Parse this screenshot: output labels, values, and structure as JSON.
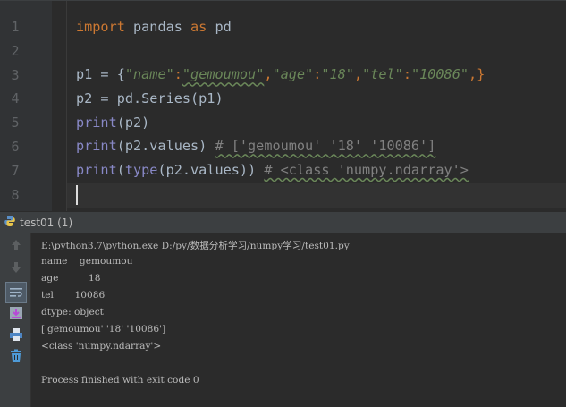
{
  "editor": {
    "line_numbers": [
      "1",
      "2",
      "3",
      "4",
      "5",
      "6",
      "7",
      "8"
    ],
    "lines": {
      "l1": {
        "kw1": "import",
        "id1": " pandas ",
        "kw2": "as",
        "id2": " pd"
      },
      "l3": {
        "a": "p1 = {",
        "s1": "\"name\"",
        "c1": ":",
        "s2": "\"gemoumou\"",
        "c2": ",",
        "s3": "\"age\"",
        "c3": ":",
        "s4": "\"18\"",
        "c4": ",",
        "s5": "\"tel\"",
        "c5": ":",
        "s6": "\"10086\"",
        "c6": ",}"
      },
      "l4": {
        "a": "p2 = pd.Series(p1)"
      },
      "l5": {
        "fn": "print",
        "a": "(p2)"
      },
      "l6": {
        "fn": "print",
        "a": "(p2.values) ",
        "cm": "# ['gemoumou' '18' '10086']"
      },
      "l7": {
        "fn": "print",
        "a": "(",
        "fn2": "type",
        "b": "(p2.values)) ",
        "cm": "# <class 'numpy.ndarray'>"
      }
    }
  },
  "run_tab": {
    "label": "test01 (1)"
  },
  "toolbar": {
    "icons": [
      "arrow-up-icon",
      "arrow-down-icon",
      "soft-wrap-icon",
      "scroll-to-end-icon",
      "print-icon",
      "trash-icon"
    ]
  },
  "console": {
    "lines": [
      "E:\\python3.7\\python.exe D:/py/数据分析学习/numpy学习/test01.py",
      "name    gemoumou",
      "age          18",
      "tel       10086",
      "dtype: object",
      "['gemoumou' '18' '10086']",
      "<class 'numpy.ndarray'>",
      "",
      "Process finished with exit code 0"
    ]
  }
}
